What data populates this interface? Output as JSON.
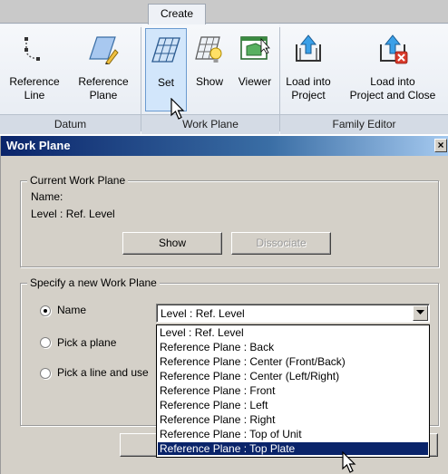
{
  "ribbon": {
    "active_tab": "Create",
    "panels": {
      "datum": {
        "title": "Datum",
        "buttons": [
          "Reference\nLine",
          "Reference\nPlane"
        ]
      },
      "work_plane": {
        "title": "Work Plane",
        "buttons": [
          "Set",
          "Show",
          "Viewer"
        ]
      },
      "family_editor": {
        "title": "Family Editor",
        "buttons": [
          "Load into\nProject",
          "Load into\nProject and Close"
        ]
      }
    },
    "labels": {
      "ref_line_1": "Reference",
      "ref_line_2": "Line",
      "ref_plane_1": "Reference",
      "ref_plane_2": "Plane",
      "set": "Set",
      "show": "Show",
      "viewer": "Viewer",
      "load_1": "Load into",
      "load_2": "Project",
      "load_close_1": "Load into",
      "load_close_2": "Project and Close"
    }
  },
  "dialog": {
    "title": "Work Plane",
    "close_glyph": "×",
    "current": {
      "legend": "Current Work Plane",
      "name_label": "Name:",
      "name_value": "Level : Ref. Level",
      "show_button": "Show",
      "dissociate_button": "Dissociate"
    },
    "specify": {
      "legend": "Specify a new Work Plane",
      "option_name": "Name",
      "option_pick_plane": "Pick a plane",
      "option_pick_line": "Pick a line and use",
      "selected_option": "Name",
      "combo_value": "Level : Ref. Level",
      "options": [
        "Level : Ref. Level",
        "Reference Plane : Back",
        "Reference Plane : Center (Front/Back)",
        "Reference Plane : Center (Left/Right)",
        "Reference Plane : Front",
        "Reference Plane : Left",
        "Reference Plane : Right",
        "Reference Plane : Top of Unit",
        "Reference Plane : Top Plate"
      ],
      "highlighted_index": 8
    }
  },
  "colors": {
    "titlebar": "#0a246a",
    "selection": "#0a246a",
    "ribbon_active": "#d2e6fb"
  }
}
